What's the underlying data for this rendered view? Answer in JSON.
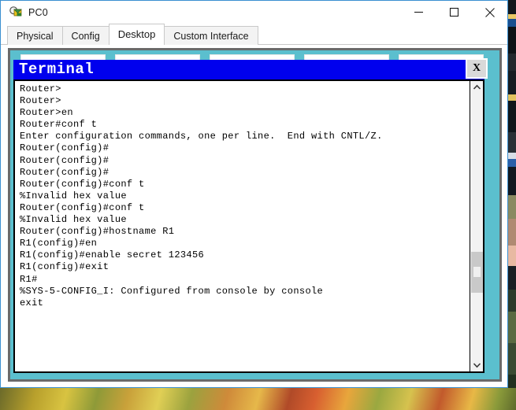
{
  "window": {
    "title": "PC0",
    "icon": "packet-tracer-magnifier-icon",
    "controls": {
      "minimize": "—",
      "maximize": "□",
      "close": "✕"
    }
  },
  "tabs": [
    {
      "label": "Physical",
      "active": false
    },
    {
      "label": "Config",
      "active": false
    },
    {
      "label": "Desktop",
      "active": true
    },
    {
      "label": "Custom Interface",
      "active": false
    }
  ],
  "desktop": {
    "background_color": "#5bbfce",
    "icon_count": 5
  },
  "terminal": {
    "title": "Terminal",
    "close_label": "X",
    "titlebar_color": "#0000ee",
    "lines": [
      "Router>",
      "Router>",
      "Router>en",
      "Router#conf t",
      "Enter configuration commands, one per line.  End with CNTL/Z.",
      "Router(config)#",
      "Router(config)#",
      "Router(config)#",
      "Router(config)#conf t",
      "%Invalid hex value",
      "Router(config)#conf t",
      "%Invalid hex value",
      "Router(config)#hostname R1",
      "R1(config)#en",
      "R1(config)#enable secret 123456",
      "R1(config)#exit",
      "R1#",
      "%SYS-5-CONFIG_I: Configured from console by console",
      "exit"
    ],
    "scrollbar": {
      "up_arrow": "∧",
      "down_arrow": "∨"
    }
  }
}
